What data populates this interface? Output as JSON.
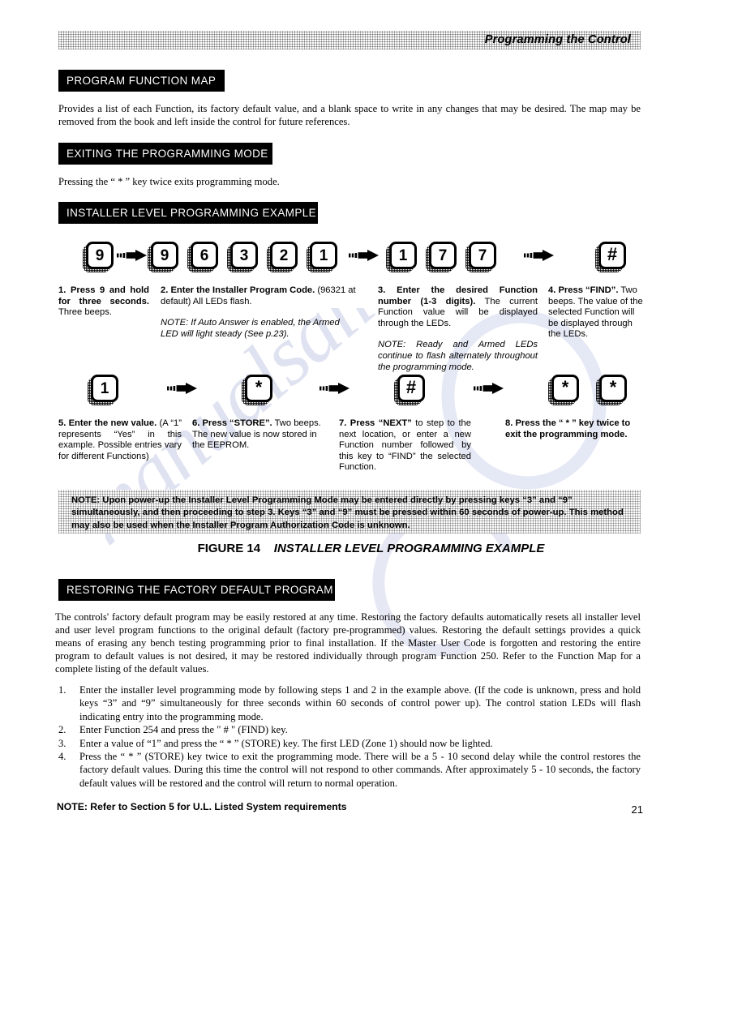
{
  "header": {
    "title": "Programming the Control"
  },
  "sections": {
    "program_function_map": {
      "bar_label": "PROGRAM FUNCTION MAP",
      "body": "Provides a list of each Function, its factory default value, and a blank space to write in any changes that may be desired.   The map may be removed from the book and left inside the control for future references."
    },
    "exiting_mode": {
      "bar_label": "EXITING THE PROGRAMMING MODE",
      "body": "Pressing the “  *  ” key twice exits programming mode."
    },
    "installer_example": {
      "bar_label": "INSTALLER LEVEL PROGRAMMING EXAMPLE"
    },
    "restoring_defaults": {
      "bar_label": "RESTORING THE FACTORY DEFAULT PROGRAM",
      "body": "The controls' factory default program may be easily restored at any time.  Restoring the factory defaults automatically resets all installer level and user level program functions to the original default (factory pre-programmed) values.  Restoring the default settings provides a quick means of erasing any bench testing programming prior to final installation.   If the Master User Code is forgotten and restoring the entire program to default values is not desired, it may be restored individually through program Function 250.  Refer to the Function Map  for a complete listing of the default values."
    }
  },
  "diagram": {
    "row1": {
      "groups": [
        {
          "keys": [
            "9"
          ]
        },
        {
          "keys": [
            "9",
            "6",
            "3",
            "2",
            "1"
          ]
        },
        {
          "keys": [
            "1",
            "7",
            "7"
          ]
        },
        {
          "keys": [
            "#"
          ]
        }
      ]
    },
    "row2": {
      "groups": [
        {
          "keys": [
            "1"
          ]
        },
        {
          "keys": [
            "*"
          ]
        },
        {
          "keys": [
            "#"
          ]
        },
        {
          "keys": [
            "*",
            "*"
          ]
        }
      ]
    },
    "steps": [
      {
        "id": "step-1",
        "bold": "1. Press 9 and hold for three seconds.",
        "rest": " Three beeps.",
        "note": ""
      },
      {
        "id": "step-2",
        "bold": "2. Enter the Installer Program Code.",
        "rest": " (96321 at default) All LEDs flash.",
        "note": "NOTE: If Auto Answer is enabled, the Armed LED will light steady (See p.23)."
      },
      {
        "id": "step-3",
        "bold": "3. Enter the desired Function number (1-3 digits).",
        "rest": "  The current Function value will be displayed through the LEDs.",
        "note": "NOTE: Ready and Armed LEDs continue to flash alternately throughout the programming mode."
      },
      {
        "id": "step-4",
        "bold": "4. Press “FIND”.",
        "rest": " Two beeps. The value of the selected Function will be displayed through the LEDs.",
        "note": ""
      },
      {
        "id": "step-5",
        "bold": "5. Enter the new value.",
        "rest": " (A “1” represents “Yes” in this example.  Possible  entries vary for different Functions)",
        "note": ""
      },
      {
        "id": "step-6",
        "bold": "6. Press “STORE”.",
        "rest": " Two beeps. The new value is now stored in the EEPROM.",
        "note": ""
      },
      {
        "id": "step-7",
        "bold": "7. Press “NEXT”",
        "rest": " to step to the next location, or enter a new Function number followed by this key to “FIND” the selected Function.",
        "note": ""
      },
      {
        "id": "step-8",
        "bold": "8. Press the “ * ” key twice to exit the programming mode.",
        "rest": "",
        "note": ""
      }
    ],
    "note_box": "NOTE: Upon power-up the Installer Level Programming Mode  may be entered directly by pressing keys “3” and “9” simultaneously, and then proceeding to step 3.  Keys “3” and “9” must be pressed within 60 seconds of power-up. This method may also be used when the Installer Program Authorization Code is unknown.",
    "figure_label": "FIGURE 14",
    "figure_title": "INSTALLER LEVEL PROGRAMMING EXAMPLE"
  },
  "restore_steps": [
    {
      "n": "1.",
      "text": "Enter the installer level programming mode by following steps 1 and 2 in the example above.  (If the code is unknown, press and hold keys “3” and “9” simultaneously for three seconds within 60 seconds of control power up).  The control station LEDs will flash indicating entry into the programming mode."
    },
    {
      "n": "2.",
      "text": "Enter Function 254 and press the \" # \" (FIND) key."
    },
    {
      "n": "3.",
      "text": "Enter a value of “1” and press the “  *  ”  (STORE) key.  The first LED (Zone 1) should now be lighted."
    },
    {
      "n": "4.",
      "text": "Press the “  *  ” (STORE) key twice to exit the programming mode.  There will be a 5 - 10 second delay while the control restores the factory default values.  During this time the control will not respond to other commands.  After approximately  5 - 10 seconds, the factory default values will be restored and the control will return to normal operation."
    }
  ],
  "footer": {
    "note": "NOTE: Refer to Section 5 for U.L. Listed System requirements",
    "page_number": "21"
  },
  "watermark": {
    "text": "manualsalive.com"
  },
  "colors": {
    "ink": "#000000",
    "bar_bg": "#000000",
    "bar_fg": "#ffffff",
    "watermark": "#b9bfe0",
    "paper": "#ffffff"
  }
}
